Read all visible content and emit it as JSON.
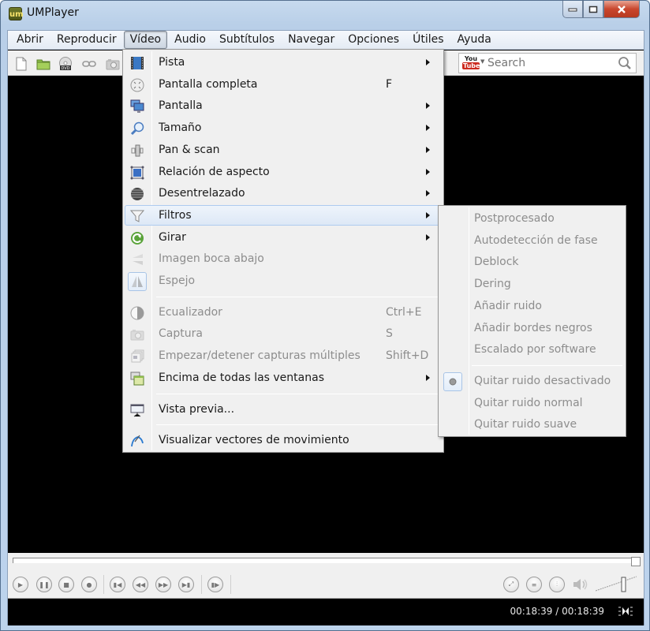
{
  "window": {
    "title": "UMPlayer",
    "app_icon": "um-logo-icon",
    "buttons": {
      "minimize": "minimize-icon",
      "maximize": "maximize-icon",
      "close": "close-icon"
    }
  },
  "menubar": {
    "items": [
      {
        "label": "Abrir"
      },
      {
        "label": "Reproducir"
      },
      {
        "label": "Vídeo",
        "active": true
      },
      {
        "label": "Audio"
      },
      {
        "label": "Subtítulos"
      },
      {
        "label": "Navegar"
      },
      {
        "label": "Opciones"
      },
      {
        "label": "Útiles"
      },
      {
        "label": "Ayuda"
      }
    ]
  },
  "toolbar": {
    "icons": [
      "new-file-icon",
      "open-folder-icon",
      "dvd-icon",
      "link-icon",
      "camera-icon"
    ],
    "youtube": {
      "logo_top": "You",
      "logo_bottom": "Tube",
      "placeholder": "Search",
      "value": ""
    }
  },
  "video_menu": {
    "items": [
      {
        "label": "Pista",
        "icon": "film-icon",
        "submenu": true
      },
      {
        "label": "Pantalla completa",
        "icon": "fullscreen-icon",
        "shortcut": "F"
      },
      {
        "label": "Pantalla",
        "icon": "monitors-icon",
        "submenu": true
      },
      {
        "label": "Tamaño",
        "icon": "magnifier-icon",
        "submenu": true
      },
      {
        "label": "Pan & scan",
        "icon": "pan-scan-icon",
        "submenu": true
      },
      {
        "label": "Relación de aspecto",
        "icon": "aspect-ratio-icon",
        "submenu": true
      },
      {
        "label": "Desentrelazado",
        "icon": "deinterlace-icon",
        "submenu": true
      },
      {
        "label": "Filtros",
        "icon": "filter-funnel-icon",
        "submenu": true,
        "highlighted": true
      },
      {
        "label": "Girar",
        "icon": "rotate-icon",
        "submenu": true
      },
      {
        "label": "Imagen boca abajo",
        "icon": "flip-icon",
        "disabled": true
      },
      {
        "label": "Espejo",
        "icon": "mirror-icon",
        "disabled": true,
        "checked": true
      },
      {
        "separator": true
      },
      {
        "label": "Ecualizador",
        "icon": "equalizer-contrast-icon",
        "shortcut": "Ctrl+E",
        "disabled": true
      },
      {
        "label": "Captura",
        "icon": "camera-icon",
        "shortcut": "S",
        "disabled": true
      },
      {
        "label": "Empezar/detener capturas múltiples",
        "icon": "multiple-captures-icon",
        "shortcut": "Shift+D",
        "disabled": true
      },
      {
        "label": "Encima de todas las ventanas",
        "icon": "windows-on-top-icon",
        "submenu": true
      },
      {
        "separator": true
      },
      {
        "label": "Vista previa...",
        "icon": "preview-screen-icon"
      },
      {
        "separator": true
      },
      {
        "label": "Visualizar vectores de movimiento",
        "icon": "motion-vectors-icon"
      }
    ]
  },
  "filters_submenu": {
    "items": [
      {
        "label": "Postprocesado",
        "disabled": true
      },
      {
        "label": "Autodetección de fase",
        "disabled": true
      },
      {
        "label": "Deblock",
        "disabled": true
      },
      {
        "label": "Dering",
        "disabled": true
      },
      {
        "label": "Añadir ruido",
        "disabled": true
      },
      {
        "label": "Añadir bordes negros",
        "disabled": true
      },
      {
        "label": "Escalado por software",
        "disabled": true
      },
      {
        "separator": true
      },
      {
        "label": "Quitar ruido desactivado",
        "disabled": true,
        "radio_selected": true
      },
      {
        "label": "Quitar ruido normal",
        "disabled": true
      },
      {
        "label": "Quitar ruido suave",
        "disabled": true
      }
    ]
  },
  "seekbar": {
    "progress_percent": 100
  },
  "controls": {
    "left": [
      "play-icon",
      "pause-icon",
      "stop-icon",
      "record-icon",
      "previous-icon",
      "rewind-icon",
      "forward-icon",
      "next-icon",
      "frame-step-icon"
    ],
    "right": [
      "fullscreen-icon",
      "playlist-icon",
      "equalizer-icon",
      "volume-icon"
    ],
    "volume_percent": 70
  },
  "status": {
    "time": "00:18:39 / 00:18:39",
    "icon": "compact-mode-icon"
  }
}
